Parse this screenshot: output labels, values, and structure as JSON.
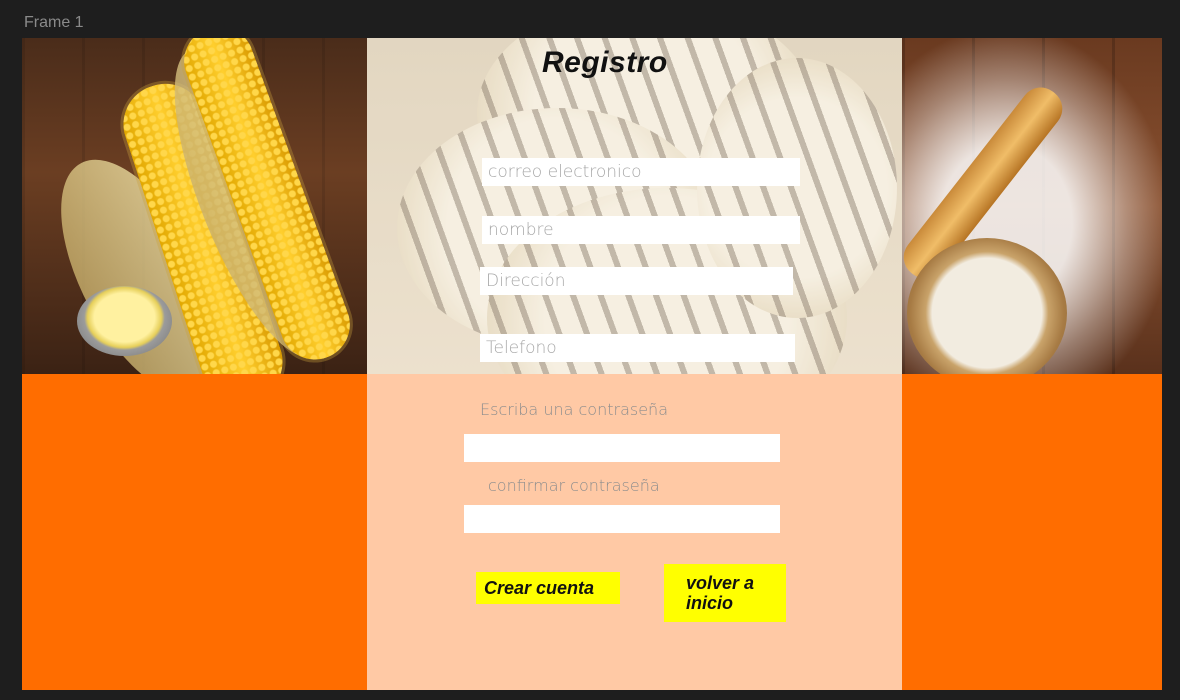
{
  "frame": {
    "label": "Frame 1"
  },
  "form": {
    "title": "Registro",
    "fields": {
      "email": {
        "placeholder": "correo electronico"
      },
      "name": {
        "placeholder": "nombre"
      },
      "address": {
        "placeholder": "Dirección"
      },
      "phone": {
        "placeholder": "Telefono"
      }
    },
    "password_label": "Escriba una contraseña",
    "confirm_label": "confirmar contraseña",
    "create_button": "Crear cuenta",
    "back_button": "volver a inicio"
  },
  "colors": {
    "background": "#1e1e1e",
    "orange": "#ff6d00",
    "peach": "#ffc9a5",
    "button": "#ffff00"
  }
}
